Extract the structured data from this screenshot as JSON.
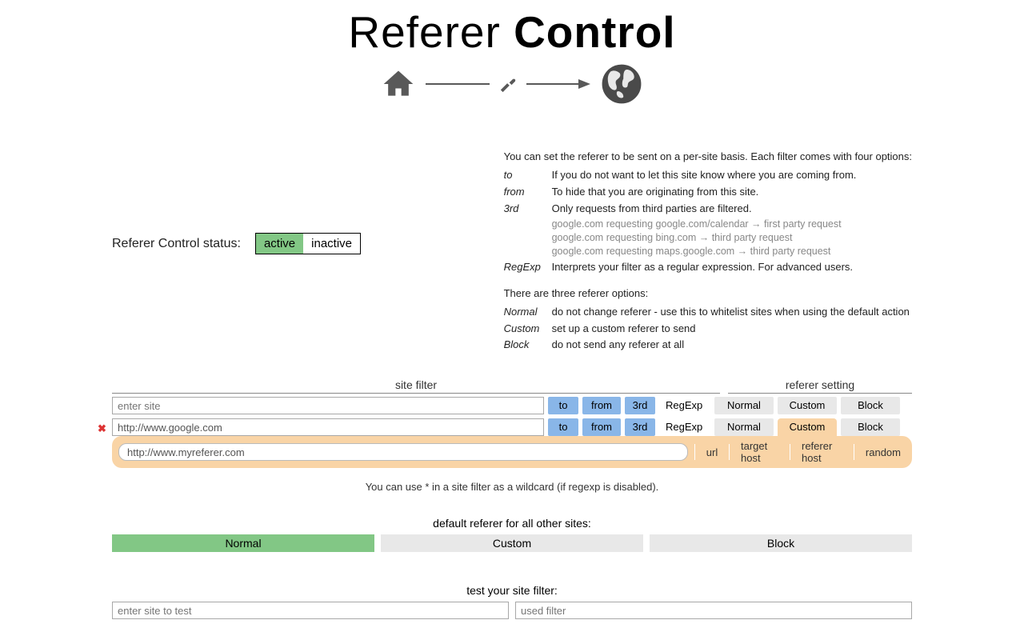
{
  "title": {
    "part1": "Referer ",
    "part2": "Control"
  },
  "status": {
    "label": "Referer Control status:",
    "active": "active",
    "inactive": "inactive"
  },
  "help": {
    "intro": "You can set the referer to be sent on a per-site basis. Each filter comes with four options:",
    "to": {
      "term": "to",
      "desc": "If you do not want to let this site know where you are coming from."
    },
    "from": {
      "term": "from",
      "desc": "To hide that you are originating from this site."
    },
    "third": {
      "term": "3rd",
      "desc": "Only requests from third parties are filtered.",
      "ex1": "google.com requesting google.com/calendar → first party request",
      "ex2": "google.com requesting bing.com → third party request",
      "ex3": "google.com requesting maps.google.com → third party request"
    },
    "regexp": {
      "term": "RegExp",
      "desc": "Interprets your filter as a regular expression. For advanced users."
    },
    "section2": "There are three referer options:",
    "normal": {
      "term": "Normal",
      "desc": "do not change referer - use this to whitelist sites when using the default action"
    },
    "custom": {
      "term": "Custom",
      "desc": "set up a custom referer to send"
    },
    "block": {
      "term": "Block",
      "desc": "do not send any referer at all"
    }
  },
  "headers": {
    "site_filter": "site filter",
    "referer_setting": "referer setting"
  },
  "filters": {
    "to": "to",
    "from": "from",
    "third": "3rd",
    "regexp": "RegExp",
    "normal": "Normal",
    "custom": "Custom",
    "block": "Block"
  },
  "row1": {
    "placeholder": "enter site"
  },
  "row2": {
    "value": "http://www.google.com"
  },
  "custom_strip": {
    "value": "http://www.myreferer.com",
    "url": "url",
    "target_host": "target host",
    "referer_host": "referer host",
    "random": "random"
  },
  "hint": "You can use * in a site filter as a wildcard (if regexp is disabled).",
  "default": {
    "title": "default referer for all other sites:",
    "normal": "Normal",
    "custom": "Custom",
    "block": "Block"
  },
  "test": {
    "title": "test your site filter:",
    "site_placeholder": "enter site to test",
    "used_placeholder": "used filter"
  }
}
